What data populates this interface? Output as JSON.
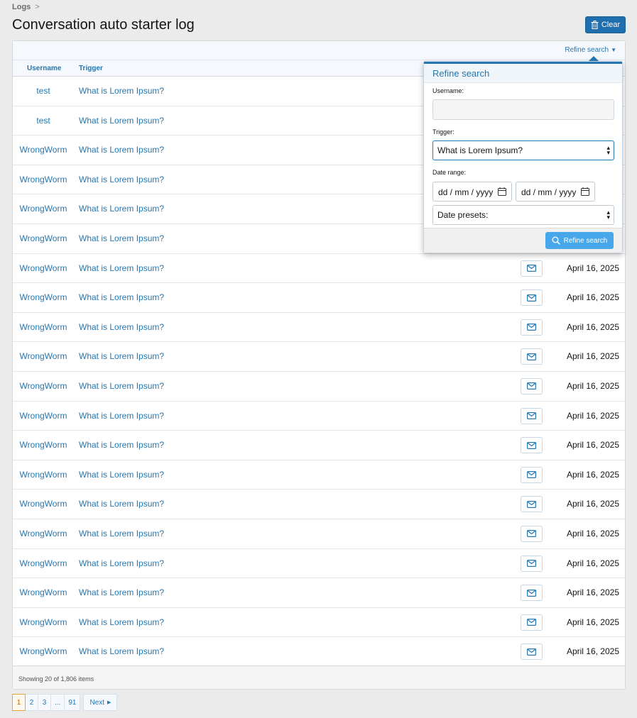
{
  "breadcrumb": {
    "item": "Logs",
    "separator": ">"
  },
  "page_title": "Conversation auto starter log",
  "clear_button": "Clear",
  "filter_bar": {
    "refine_link": "Refine search"
  },
  "table": {
    "headers": {
      "username": "Username",
      "trigger": "Trigger"
    },
    "rows": [
      {
        "username": "test",
        "trigger": "What is Lorem Ipsum?",
        "date": ""
      },
      {
        "username": "test",
        "trigger": "What is Lorem Ipsum?",
        "date": ""
      },
      {
        "username": "WrongWorm",
        "trigger": "What is Lorem Ipsum?",
        "date": ""
      },
      {
        "username": "WrongWorm",
        "trigger": "What is Lorem Ipsum?",
        "date": ""
      },
      {
        "username": "WrongWorm",
        "trigger": "What is Lorem Ipsum?",
        "date": ""
      },
      {
        "username": "WrongWorm",
        "trigger": "What is Lorem Ipsum?",
        "date": ""
      },
      {
        "username": "WrongWorm",
        "trigger": "What is Lorem Ipsum?",
        "date": "April 16, 2025"
      },
      {
        "username": "WrongWorm",
        "trigger": "What is Lorem Ipsum?",
        "date": "April 16, 2025"
      },
      {
        "username": "WrongWorm",
        "trigger": "What is Lorem Ipsum?",
        "date": "April 16, 2025"
      },
      {
        "username": "WrongWorm",
        "trigger": "What is Lorem Ipsum?",
        "date": "April 16, 2025"
      },
      {
        "username": "WrongWorm",
        "trigger": "What is Lorem Ipsum?",
        "date": "April 16, 2025"
      },
      {
        "username": "WrongWorm",
        "trigger": "What is Lorem Ipsum?",
        "date": "April 16, 2025"
      },
      {
        "username": "WrongWorm",
        "trigger": "What is Lorem Ipsum?",
        "date": "April 16, 2025"
      },
      {
        "username": "WrongWorm",
        "trigger": "What is Lorem Ipsum?",
        "date": "April 16, 2025"
      },
      {
        "username": "WrongWorm",
        "trigger": "What is Lorem Ipsum?",
        "date": "April 16, 2025"
      },
      {
        "username": "WrongWorm",
        "trigger": "What is Lorem Ipsum?",
        "date": "April 16, 2025"
      },
      {
        "username": "WrongWorm",
        "trigger": "What is Lorem Ipsum?",
        "date": "April 16, 2025"
      },
      {
        "username": "WrongWorm",
        "trigger": "What is Lorem Ipsum?",
        "date": "April 16, 2025"
      },
      {
        "username": "WrongWorm",
        "trigger": "What is Lorem Ipsum?",
        "date": "April 16, 2025"
      },
      {
        "username": "WrongWorm",
        "trigger": "What is Lorem Ipsum?",
        "date": "April 16, 2025"
      }
    ],
    "row_icon": "envelope-icon",
    "footer": "Showing 20 of 1,806 items"
  },
  "pagination": {
    "pages": [
      "1",
      "2",
      "3",
      "...",
      "91"
    ],
    "current": "1",
    "next": "Next"
  },
  "refine_popup": {
    "title": "Refine search",
    "username_label": "Username:",
    "username_value": "",
    "trigger_label": "Trigger:",
    "trigger_value": "What is Lorem Ipsum?",
    "date_range_label": "Date range:",
    "date_from_placeholder": "dd / mm / yyyy",
    "date_to_placeholder": "dd / mm / yyyy",
    "date_presets": "Date presets:",
    "submit": "Refine search"
  },
  "colors": {
    "accent": "#2577b1",
    "button": "#1f6fae",
    "refine_button": "#47a7eb",
    "current_page": "#e6a437"
  }
}
